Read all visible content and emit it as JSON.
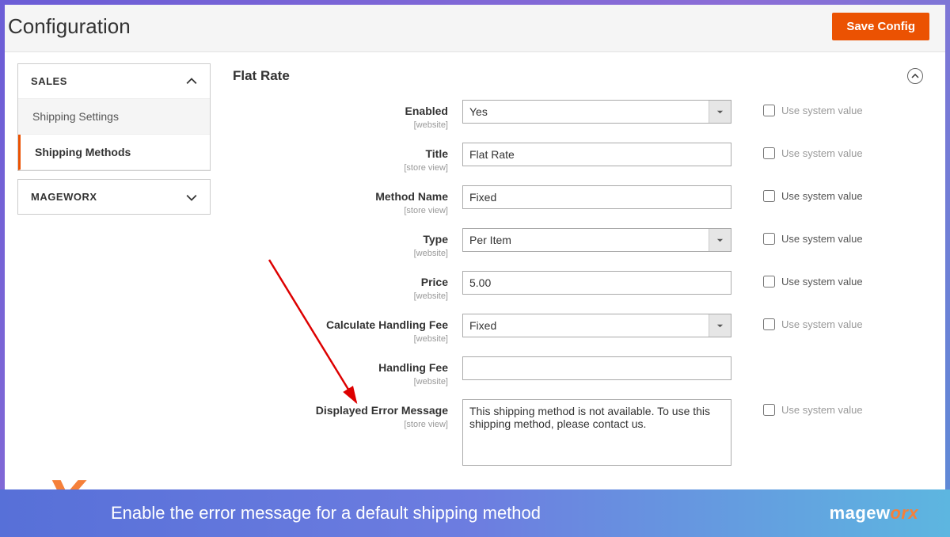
{
  "page": {
    "title": "Configuration"
  },
  "actions": {
    "save": "Save Config"
  },
  "sidebar": {
    "groups": [
      {
        "label": "SALES",
        "expanded": true,
        "items": [
          {
            "label": "Shipping Settings",
            "active": false
          },
          {
            "label": "Shipping Methods",
            "active": true
          }
        ]
      },
      {
        "label": "MAGEWORX",
        "expanded": false,
        "items": []
      }
    ]
  },
  "section": {
    "title": "Flat Rate"
  },
  "fields": {
    "enabled": {
      "label": "Enabled",
      "scope": "[website]",
      "value": "Yes",
      "type": "select",
      "use_sys_dark": false
    },
    "title": {
      "label": "Title",
      "scope": "[store view]",
      "value": "Flat Rate",
      "type": "text",
      "use_sys_dark": false
    },
    "method": {
      "label": "Method Name",
      "scope": "[store view]",
      "value": "Fixed",
      "type": "text",
      "use_sys_dark": true
    },
    "typef": {
      "label": "Type",
      "scope": "[website]",
      "value": "Per Item",
      "type": "select",
      "use_sys_dark": true
    },
    "price": {
      "label": "Price",
      "scope": "[website]",
      "value": "5.00",
      "type": "text",
      "use_sys_dark": true
    },
    "calc": {
      "label": "Calculate Handling Fee",
      "scope": "[website]",
      "value": "Fixed",
      "type": "select",
      "use_sys_dark": false
    },
    "hfee": {
      "label": "Handling Fee",
      "scope": "[website]",
      "value": "",
      "type": "text",
      "use_sys_dark": null
    },
    "errmsg": {
      "label": "Displayed Error Message",
      "scope": "[store view]",
      "value": "This shipping method is not available. To use this shipping method, please contact us.",
      "type": "textarea",
      "use_sys_dark": false
    }
  },
  "use_system_label": "Use system value",
  "caption": "Enable the error message for a default shipping method",
  "brand": {
    "part1": "magew",
    "part2": "orx"
  }
}
